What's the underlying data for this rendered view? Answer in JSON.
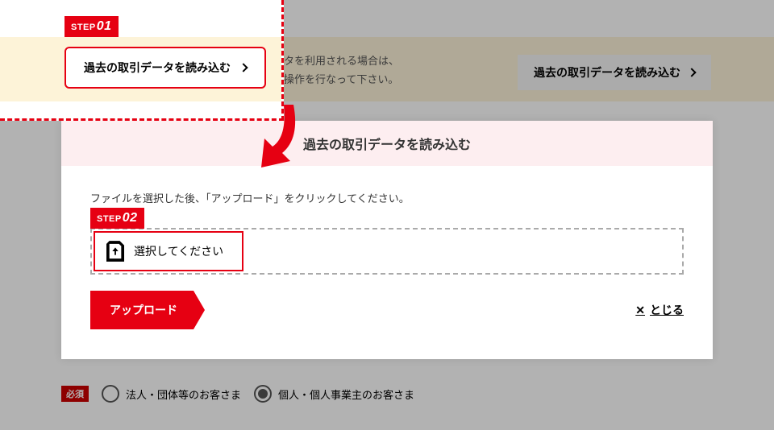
{
  "banner": {
    "text_line1": "タを利用される場合は、",
    "text_line2": "操作を行なって下さい。",
    "button_label": "過去の取引データを読み込む"
  },
  "step1": {
    "badge_prefix": "STEP",
    "badge_num": "01",
    "button_label": "過去の取引データを読み込む"
  },
  "modal": {
    "title": "過去の取引データを読み込む",
    "instruction": "ファイルを選択した後、「アップロード」をクリックしてください。",
    "step2_badge_prefix": "STEP",
    "step2_badge_num": "02",
    "file_placeholder": "選択してください",
    "upload_label": "アップロード",
    "close_label": "とじる"
  },
  "required": {
    "badge": "必須",
    "option1": "法人・団体等のお客さま",
    "option2": "個人・個人事業主のお客さま"
  }
}
